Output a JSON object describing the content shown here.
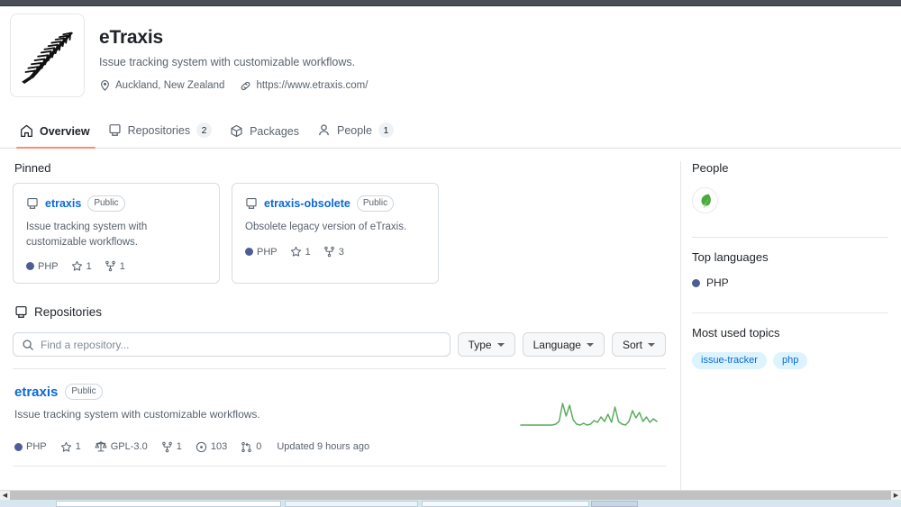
{
  "profile": {
    "avatar_icon": "silver-fern-logo",
    "name": "eTraxis",
    "bio": "Issue tracking system with customizable workflows.",
    "location": "Auckland, New Zealand",
    "location_icon": "location-pin-icon",
    "website": "https://www.etraxis.com/",
    "website_icon": "link-icon"
  },
  "nav": {
    "tabs": [
      {
        "label": "Overview",
        "icon": "home-icon",
        "count": "",
        "active": true
      },
      {
        "label": "Repositories",
        "icon": "repo-icon",
        "count": "2",
        "active": false
      },
      {
        "label": "Packages",
        "icon": "package-icon",
        "count": "",
        "active": false
      },
      {
        "label": "People",
        "icon": "person-icon",
        "count": "1",
        "active": false
      }
    ],
    "active_underline_color": "#fd8c73"
  },
  "pinned": {
    "title": "Pinned",
    "cards": [
      {
        "icon": "repo-icon",
        "name": "etraxis",
        "visibility": "Public",
        "description": "Issue tracking system with customizable workflows.",
        "language": "PHP",
        "language_color": "#4F5D95",
        "stars": "1",
        "forks": "1"
      },
      {
        "icon": "repo-icon",
        "name": "etraxis-obsolete",
        "visibility": "Public",
        "description": "Obsolete legacy version of eTraxis.",
        "language": "PHP",
        "language_color": "#4F5D95",
        "stars": "1",
        "forks": "3"
      }
    ]
  },
  "repositories": {
    "title": "Repositories",
    "title_icon": "repo-icon",
    "search": {
      "placeholder": "Find a repository...",
      "value": "",
      "icon": "search-icon"
    },
    "filters": [
      {
        "label": "Type"
      },
      {
        "label": "Language"
      },
      {
        "label": "Sort"
      }
    ],
    "items": [
      {
        "name": "etraxis",
        "visibility": "Public",
        "description": "Issue tracking system with customizable workflows.",
        "language": "PHP",
        "language_color": "#4F5D95",
        "stars": "1",
        "license": "GPL-3.0",
        "forks": "1",
        "issues": "103",
        "pull_requests": "0",
        "updated": "Updated 9 hours ago",
        "activity_color": "#57ab5a"
      }
    ]
  },
  "sidebar": {
    "people": {
      "title": "People",
      "avatars": [
        {
          "name": "leaf-avatar"
        }
      ]
    },
    "top_languages": {
      "title": "Top languages",
      "items": [
        {
          "label": "PHP",
          "color": "#4F5D95"
        }
      ]
    },
    "most_used_topics": {
      "title": "Most used topics",
      "chips": [
        {
          "label": "issue-tracker"
        },
        {
          "label": "php"
        }
      ],
      "chip_bg": "#ddf4ff",
      "chip_color": "#0969da"
    }
  },
  "chrome": {
    "scrollbar_left_arrow": "◀",
    "scrollbar_right_arrow": "▶"
  }
}
